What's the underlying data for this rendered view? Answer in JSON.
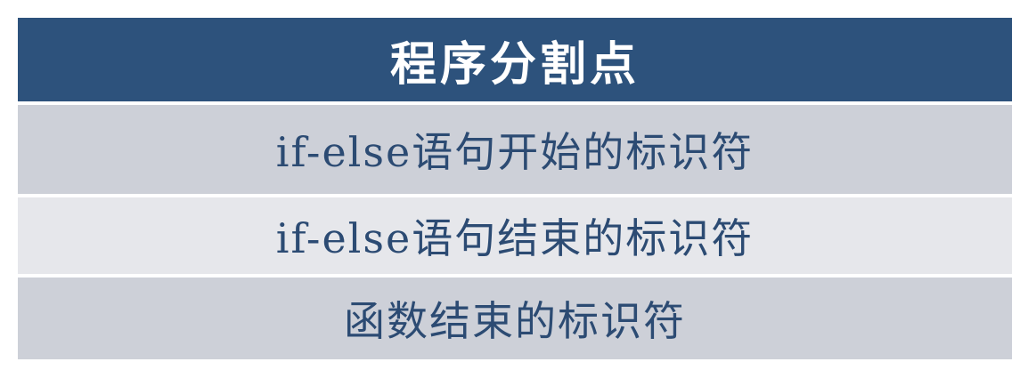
{
  "table": {
    "header": "程序分割点",
    "rows": [
      "if-else语句开始的标识符",
      "if-else语句结束的标识符",
      "函数结束的标识符"
    ]
  },
  "colors": {
    "header_bg": "#2d527c",
    "header_text": "#ffffff",
    "row_bg_dark": "#cdd0d8",
    "row_bg_light": "#e6e7eb",
    "row_text": "#2c4b73"
  }
}
